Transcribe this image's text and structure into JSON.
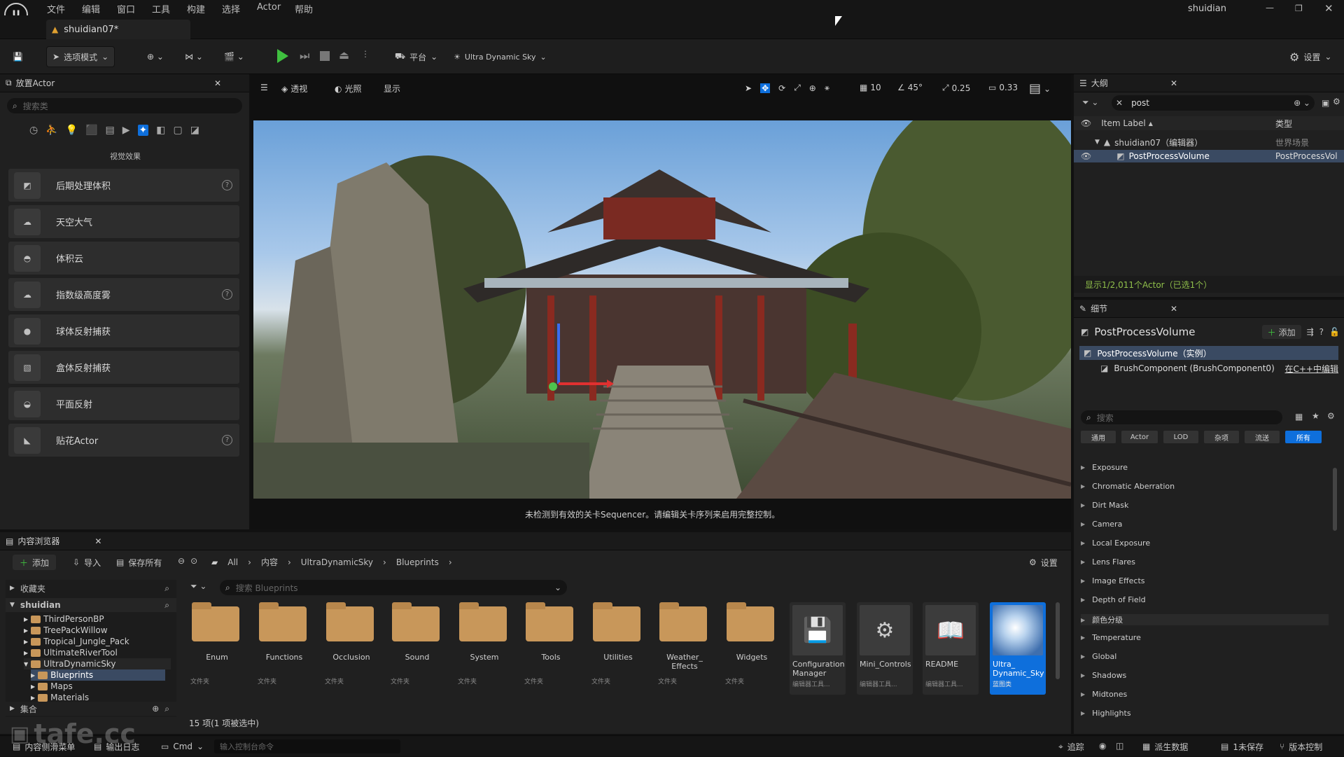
{
  "titlebar": {
    "menu": [
      "文件",
      "编辑",
      "窗口",
      "工具",
      "构建",
      "选择",
      "Actor",
      "帮助"
    ],
    "project": "shuidian"
  },
  "tab": {
    "label": "shuidian07*"
  },
  "toolbar": {
    "mode": "选项模式",
    "platform": "平台",
    "sky": "Ultra Dynamic Sky",
    "settings": "设置"
  },
  "place_actor": {
    "title": "放置Actor",
    "search_placeholder": "搜索类",
    "category": "视觉效果",
    "items": [
      "后期处理体积",
      "天空大气",
      "体积云",
      "指数级高度雾",
      "球体反射捕获",
      "盒体反射捕获",
      "平面反射",
      "贴花Actor"
    ]
  },
  "viewport": {
    "perspective": "透视",
    "lighting": "光照",
    "show": "显示",
    "grid": "10",
    "angle": "45°",
    "scale": "0.25",
    "camera_speed": "0.33",
    "message": "未检测到有效的关卡Sequencer。请编辑关卡序列来启用完整控制。"
  },
  "outliner": {
    "title": "大纲",
    "search_value": "post",
    "col_label": "Item Label",
    "col_type": "类型",
    "world_row": "shuidian07（编辑器）",
    "world_type": "世界场景",
    "actor_row": "PostProcessVolume",
    "actor_type": "PostProcessVol",
    "status": "显示1/2,011个Actor（已选1个）"
  },
  "details": {
    "title": "细节",
    "object": "PostProcessVolume",
    "add": "添加",
    "instance": "PostProcessVolume（实例）",
    "component": "BrushComponent (BrushComponent0)",
    "edit_cpp": "在C++中编辑",
    "search_placeholder": "搜索",
    "filters": [
      "通用",
      "Actor",
      "LOD",
      "杂项",
      "流送",
      "所有"
    ],
    "categories": [
      "Exposure",
      "Chromatic Aberration",
      "Dirt Mask",
      "Camera",
      "Local Exposure",
      "Lens Flares",
      "Image Effects",
      "Depth of Field",
      "颜色分级",
      "Temperature",
      "Global",
      "Shadows",
      "Midtones",
      "Highlights"
    ]
  },
  "content_browser": {
    "title": "内容浏览器",
    "add": "添加",
    "import": "导入",
    "save_all": "保存所有",
    "path": [
      "All",
      "内容",
      "UltraDynamicSky",
      "Blueprints"
    ],
    "settings": "设置",
    "favorites": "收藏夹",
    "root": "shuidian",
    "tree": [
      "ThirdPersonBP",
      "TreePackWillow",
      "Tropical_Jungle_Pack",
      "UltimateRiverTool",
      "UltraDynamicSky",
      "Blueprints",
      "Maps",
      "Materials"
    ],
    "collections": "集合",
    "search_placeholder": "搜索 Blueprints",
    "folders": [
      "Enum",
      "Functions",
      "Occlusion",
      "Sound",
      "System",
      "Tools",
      "Utilities",
      "Weather_ Effects",
      "Widgets"
    ],
    "folder_type": "文件夹",
    "assets": [
      {
        "name": "Configuration_ Manager",
        "type": "编辑器工具..."
      },
      {
        "name": "Mini_Controls",
        "type": "编辑器工具..."
      },
      {
        "name": "README",
        "type": "编辑器工具..."
      },
      {
        "name": "Ultra_ Dynamic_Sky",
        "type": "蓝图类"
      }
    ],
    "count": "15 项(1 项被选中)"
  },
  "statusbar": {
    "drawer": "内容侧滑菜单",
    "log": "输出日志",
    "cmd": "Cmd",
    "console_placeholder": "输入控制台命令",
    "trace": "追踪",
    "derived": "派生数据",
    "unsaved": "1未保存",
    "version": "版本控制"
  },
  "watermark": "tafe.cc",
  "colors": {
    "accent": "#0e6fdc",
    "highlight": "#c9d33c",
    "folder": "#c8975a"
  }
}
